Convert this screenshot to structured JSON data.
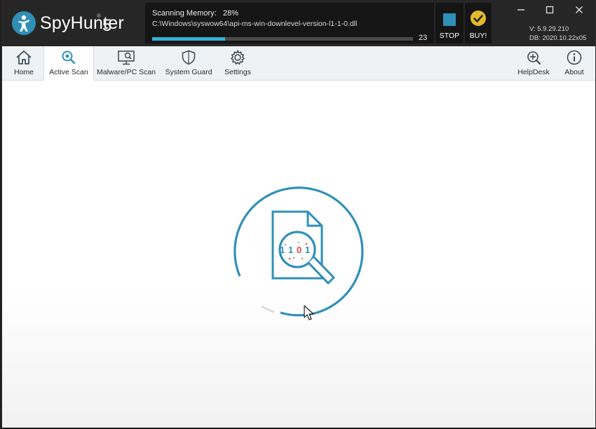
{
  "app": {
    "name": "SpyHunter",
    "name_suffix": "5",
    "logo_icon": "spyhunter-figure-icon"
  },
  "scan": {
    "label": "Scanning Memory:",
    "percent_text": "28%",
    "progress": 0.28,
    "current_file": "C:\\Windows\\syswow64\\api-ms-win-downlevel-version-l1-1-0.dll",
    "count": "23"
  },
  "actions": {
    "stop_label": "STOP",
    "buy_label": "BUY!"
  },
  "version_info": {
    "version": "V: 5.9.29.210",
    "db": "DB: 2020.10.22x05"
  },
  "toolbar": {
    "items": [
      {
        "label": "Home",
        "icon": "home-icon"
      },
      {
        "label": "Active Scan",
        "icon": "magnifier-icon"
      },
      {
        "label": "Malware/PC Scan",
        "icon": "pc-scan-icon"
      },
      {
        "label": "System Guard",
        "icon": "shield-icon"
      },
      {
        "label": "Settings",
        "icon": "gear-icon"
      }
    ],
    "right_items": [
      {
        "label": "HelpDesk",
        "icon": "helpdesk-icon"
      },
      {
        "label": "About",
        "icon": "info-icon"
      }
    ],
    "active": "Active Scan"
  },
  "graphic": {
    "binary_text": "1 1 0 1",
    "icon": "document-magnifier-icon"
  },
  "colors": {
    "accent": "#2f90b8",
    "progress": "#2fb3d6",
    "buy": "#e3b92c",
    "titlebar": "#262626",
    "toolbar": "#eef2f5"
  }
}
